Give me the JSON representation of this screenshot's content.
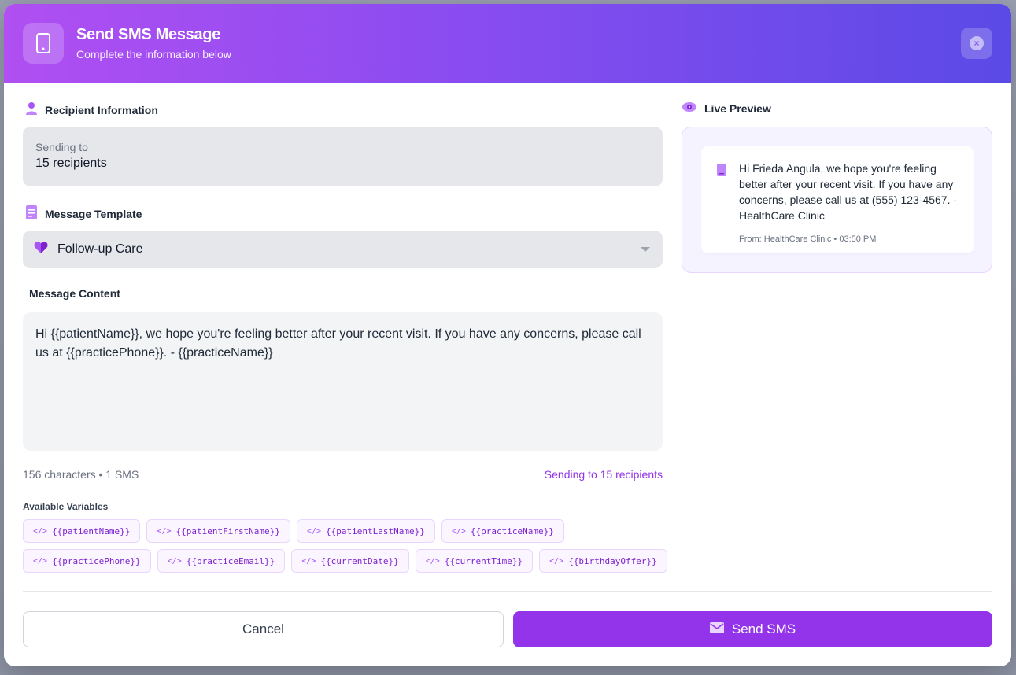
{
  "header": {
    "title": "Send SMS Message",
    "subtitle": "Complete the information below"
  },
  "recipient": {
    "section_label": "Recipient Information",
    "sending_label": "Sending to",
    "count_text": "15 recipients"
  },
  "template": {
    "section_label": "Message Template",
    "selected": "Follow-up Care"
  },
  "content": {
    "section_label": "Message Content",
    "text": "Hi {{patientName}}, we hope you're feeling better after your recent visit. If you have any concerns, please call us at {{practicePhone}}. - {{practiceName}}",
    "char_info": "156 characters • 1 SMS",
    "sending_info": "Sending to 15 recipients"
  },
  "variables": {
    "label": "Available Variables",
    "row1": [
      "{{patientName}}",
      "{{patientFirstName}}",
      "{{patientLastName}}",
      "{{practiceName}}"
    ],
    "row2": [
      "{{practicePhone}}",
      "{{practiceEmail}}",
      "{{currentDate}}",
      "{{currentTime}}",
      "{{birthdayOffer}}"
    ]
  },
  "preview": {
    "section_label": "Live Preview",
    "message": "Hi Frieda Angula, we hope you're feeling better after your recent visit. If you have any concerns, please call us at (555) 123-4567. - HealthCare Clinic",
    "from_line": "From: HealthCare Clinic • 03:50 PM"
  },
  "actions": {
    "cancel_label": "Cancel",
    "send_label": "Send SMS"
  },
  "colors": {
    "accent": "#9333ea",
    "header_start": "#b04ff2",
    "header_end": "#5b4ae6"
  }
}
